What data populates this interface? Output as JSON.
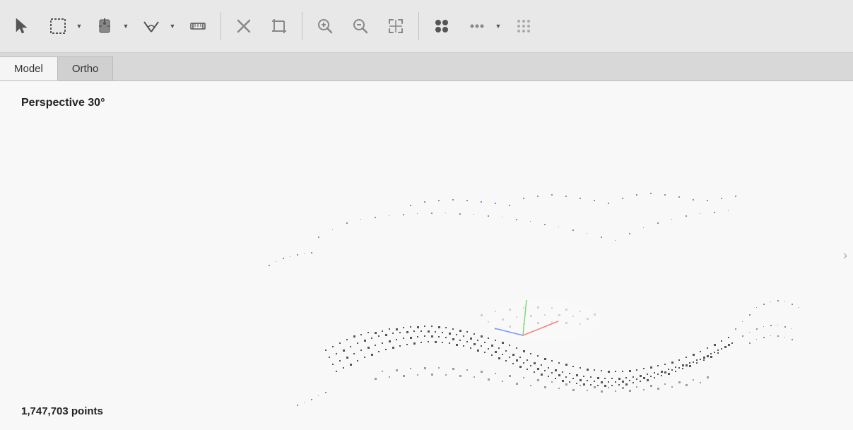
{
  "toolbar": {
    "tools": [
      {
        "name": "select",
        "label": "Select"
      },
      {
        "name": "rectangle-select",
        "label": "Rectangle Select"
      },
      {
        "name": "move",
        "label": "Move"
      },
      {
        "name": "rotate",
        "label": "Rotate"
      },
      {
        "name": "measure",
        "label": "Measure"
      },
      {
        "name": "delete",
        "label": "Delete"
      },
      {
        "name": "crop",
        "label": "Crop"
      },
      {
        "name": "zoom-in",
        "label": "Zoom In"
      },
      {
        "name": "zoom-out",
        "label": "Zoom Out"
      },
      {
        "name": "fit-view",
        "label": "Fit View"
      },
      {
        "name": "dots-grid",
        "label": "Dots Grid"
      },
      {
        "name": "more",
        "label": "More"
      }
    ]
  },
  "tabs": [
    {
      "id": "model",
      "label": "Model",
      "active": false
    },
    {
      "id": "ortho",
      "label": "Ortho",
      "active": true
    }
  ],
  "viewport": {
    "perspective_label": "Perspective 30°",
    "points_label": "1,747,703 points"
  }
}
